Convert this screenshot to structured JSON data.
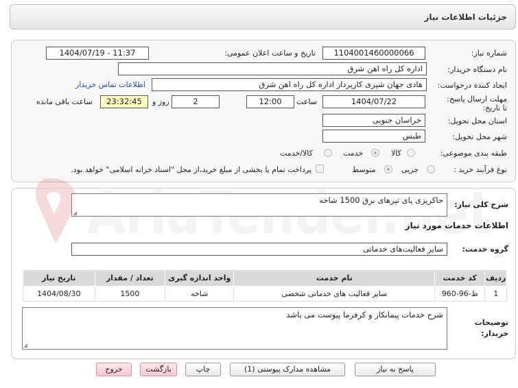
{
  "header": {
    "title": "جزئیات اطلاعات نیاز"
  },
  "form": {
    "need_number_label": "شماره نیاز:",
    "need_number": "1104001460000066",
    "announce_label": "تاریخ و ساعت اعلان عمومی:",
    "announce_value": "1404/07/19 - 11:37",
    "buyer_org_label": "نام دستگاه خریدار:",
    "buyer_org": "اداره کل راه اهن شرق",
    "creator_label": "ایجاد کننده درخواست:",
    "creator": "هادی جهان شیری کارپرداز اداره کل راه اهن شرق",
    "contact_link": "اطلاعات تماس خریدار",
    "deadline_label": "مهلت ارسال پاسخ: تا تاریخ:",
    "deadline_date": "1404/07/22",
    "hour_label": "ساعت",
    "deadline_time": "12:00",
    "days_value": "2",
    "days_label": "روز و",
    "remaining_time": "23:32:45",
    "remaining_label": "ساعت باقی مانده",
    "province_label": "استان محل تحویل:",
    "province": "خراسان جنوبی",
    "city_label": "شهر محل تحویل:",
    "city": "طبس",
    "category_label": "طبقه بندی موضوعی:",
    "category_options": [
      "کالا",
      "خدمت",
      "کالا/خدمت"
    ],
    "category_selected": "خدمت",
    "process_label": "نوع فرآیند خرید :",
    "process_options": [
      "جزیی",
      "متوسط"
    ],
    "process_selected": "متوسط",
    "payment_note": "پرداخت تمام یا بخشی از مبلغ خرید،از محل \"اسناد خزانه اسلامی\" خواهد بود."
  },
  "description": {
    "label": "شرح کلی نیاز:",
    "text": "حاکریزی پای تیرهای برق       1500 شاخه"
  },
  "services": {
    "section_title": "اطلاعات خدمات مورد نیاز",
    "group_label": "گروه خدمت:",
    "group_value": "سایر فعالیت‌های خدماتی",
    "columns": [
      "ردیف",
      "کد خدمت",
      "نام خدمت",
      "واحد اندازه گیری",
      "تعداد / مقدار",
      "تاریخ نیاز"
    ],
    "rows": [
      {
        "row": "1",
        "code": "ط-96-960",
        "name": "سایر فعالیت های خدماتی شخصی",
        "unit": "شاخه",
        "qty": "1500",
        "date": "1404/08/30"
      }
    ]
  },
  "buyer_notes": {
    "label": "توضیحات خریدار:",
    "text": "شرح خدمات پیمانکار و کرفرما پیوست می باشد"
  },
  "buttons": {
    "reply": "پاسخ به نیاز",
    "attachments": "مشاهده مدارک پیوستی (1)",
    "print": "چاپ",
    "back": "بازگشت",
    "exit": "خروج"
  },
  "watermark": {
    "text": "AriaTender.net"
  },
  "colors": {
    "highlight": "#ffffc0",
    "link": "#1a4fb5",
    "header_bg": "#d9d9d9",
    "exit_btn": "#f8c9d1"
  }
}
